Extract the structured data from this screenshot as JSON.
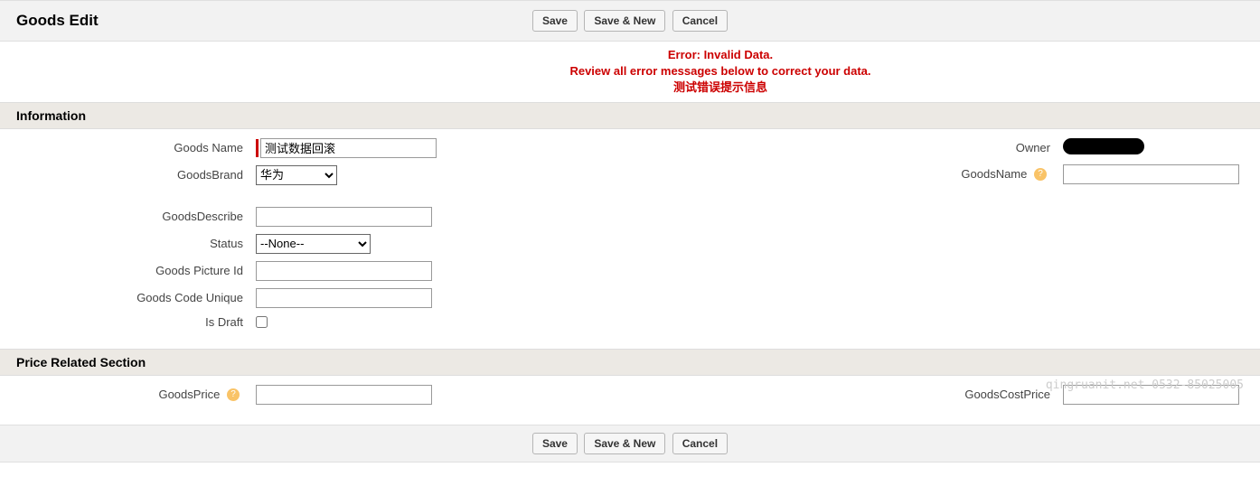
{
  "page_title": "Goods Edit",
  "buttons": {
    "save": "Save",
    "save_new": "Save & New",
    "cancel": "Cancel"
  },
  "error": {
    "line1": "Error: Invalid Data.",
    "line2": "Review all error messages below to correct your data.",
    "line3": "测试错误提示信息"
  },
  "sections": {
    "information": "Information",
    "price": "Price Related Section"
  },
  "fields": {
    "goods_name": {
      "label": "Goods Name",
      "value": "测试数据回滚"
    },
    "goods_brand": {
      "label": "GoodsBrand",
      "value": "华为"
    },
    "goods_describe": {
      "label": "GoodsDescribe",
      "value": ""
    },
    "status": {
      "label": "Status",
      "value": "--None--"
    },
    "goods_picture_id": {
      "label": "Goods Picture Id",
      "value": ""
    },
    "goods_code_unique": {
      "label": "Goods Code Unique",
      "value": ""
    },
    "is_draft": {
      "label": "Is Draft",
      "checked": false
    },
    "owner": {
      "label": "Owner"
    },
    "goods_name_right": {
      "label": "GoodsName",
      "value": ""
    },
    "goods_price": {
      "label": "GoodsPrice",
      "value": ""
    },
    "goods_cost_price": {
      "label": "GoodsCostPrice",
      "value": ""
    }
  },
  "watermark": "qingruanit.net 0532-85025005"
}
